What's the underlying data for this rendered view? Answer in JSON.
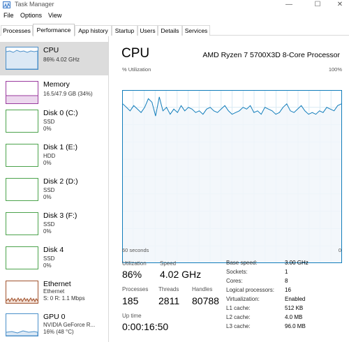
{
  "window": {
    "title": "Task Manager",
    "controls": {
      "minimize": "—",
      "maximize": "☐",
      "close": "✕"
    }
  },
  "menu": [
    "File",
    "Options",
    "View"
  ],
  "tabs": [
    "Processes",
    "Performance",
    "App history",
    "Startup",
    "Users",
    "Details",
    "Services"
  ],
  "active_tab": "Performance",
  "sidebar": {
    "items": [
      {
        "name": "CPU",
        "line1": "86% 4.02 GHz",
        "line2": "",
        "line3": "",
        "color": "#4a8fc9",
        "selected": true
      },
      {
        "name": "Memory",
        "line1": "16.5/47.9 GB (34%)",
        "line2": "",
        "line3": "",
        "color": "#9a3a9e",
        "selected": false
      },
      {
        "name": "Disk 0 (C:)",
        "line1": "SSD",
        "line2": "0%",
        "line3": "",
        "color": "#4ca34c",
        "selected": false
      },
      {
        "name": "Disk 1 (E:)",
        "line1": "HDD",
        "line2": "0%",
        "line3": "",
        "color": "#4ca34c",
        "selected": false
      },
      {
        "name": "Disk 2 (D:)",
        "line1": "SSD",
        "line2": "0%",
        "line3": "",
        "color": "#4ca34c",
        "selected": false
      },
      {
        "name": "Disk 3 (F:)",
        "line1": "SSD",
        "line2": "0%",
        "line3": "",
        "color": "#4ca34c",
        "selected": false
      },
      {
        "name": "Disk 4",
        "line1": "SSD",
        "line2": "0%",
        "line3": "",
        "color": "#4ca34c",
        "selected": false
      },
      {
        "name": "Ethernet",
        "line1": "Ethernet",
        "line2": "S: 0 R: 1.1 Mbps",
        "line3": "",
        "color": "#a0522d",
        "selected": false
      },
      {
        "name": "GPU 0",
        "line1": "NVIDIA GeForce R...",
        "line2": "16% (48 °C)",
        "line3": "",
        "color": "#4a8fc9",
        "selected": false
      }
    ]
  },
  "main": {
    "title": "CPU",
    "model": "AMD Ryzen 7 5700X3D 8-Core Processor",
    "util_label": "% Utilization",
    "util_max": "100%",
    "secs_label": "60 seconds",
    "secs_zero": "0",
    "stats": {
      "utilization_label": "Utilization",
      "utilization": "86%",
      "speed_label": "Speed",
      "speed": "4.02 GHz",
      "processes_label": "Processes",
      "processes": "185",
      "threads_label": "Threads",
      "threads": "2811",
      "handles_label": "Handles",
      "handles": "80788",
      "uptime_label": "Up time",
      "uptime": "0:00:16:50"
    },
    "properties": [
      {
        "label": "Base speed:",
        "value": "3.00 GHz"
      },
      {
        "label": "Sockets:",
        "value": "1"
      },
      {
        "label": "Cores:",
        "value": "8"
      },
      {
        "label": "Logical processors:",
        "value": "16"
      },
      {
        "label": "Virtualization:",
        "value": "Enabled"
      },
      {
        "label": "L1 cache:",
        "value": "512 KB"
      },
      {
        "label": "L2 cache:",
        "value": "4.0 MB"
      },
      {
        "label": "L3 cache:",
        "value": "96.0 MB"
      }
    ],
    "cpu_history": [
      92,
      90,
      88,
      91,
      89,
      87,
      90,
      95,
      93,
      85,
      96,
      88,
      90,
      86,
      89,
      87,
      91,
      88,
      90,
      89,
      87,
      88,
      86,
      89,
      90,
      88,
      87,
      89,
      91,
      88,
      86,
      87,
      88,
      90,
      89,
      91,
      87,
      88,
      86,
      90,
      89,
      88,
      86,
      87,
      90,
      92,
      88,
      87,
      89,
      91,
      88,
      86,
      87,
      86,
      88,
      87,
      90,
      89,
      88,
      91,
      92
    ]
  },
  "colors": {
    "accent": "#117dbb",
    "graph_fill": "#f1f6fa",
    "grid": "#d9eaf4"
  }
}
